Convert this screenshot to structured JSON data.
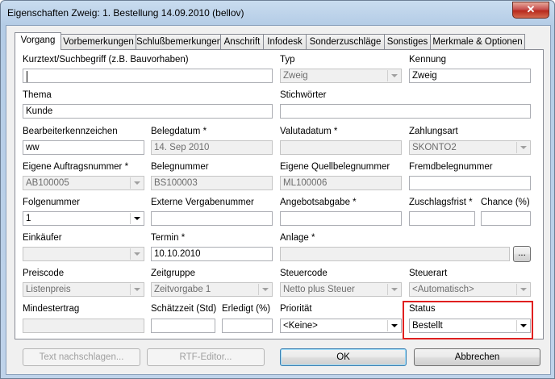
{
  "window": {
    "title": "Eigenschaften Zweig: 1. Bestellung 14.09.2010 (bellov)",
    "close_label": "✕"
  },
  "tabs": [
    {
      "label": "Vorgang"
    },
    {
      "label": "Vorbemerkungen"
    },
    {
      "label": "Schlußbemerkungen"
    },
    {
      "label": "Anschrift"
    },
    {
      "label": "Infodesk"
    },
    {
      "label": "Sonderzuschläge"
    },
    {
      "label": "Sonstiges"
    },
    {
      "label": "Merkmale & Optionen"
    }
  ],
  "fields": {
    "kurztext": {
      "label": "Kurztext/Suchbegriff (z.B. Bauvorhaben)",
      "value": ""
    },
    "typ": {
      "label": "Typ",
      "value": "Zweig"
    },
    "kennung": {
      "label": "Kennung",
      "value": "Zweig"
    },
    "thema": {
      "label": "Thema",
      "value": "Kunde"
    },
    "stichwoerter": {
      "label": "Stichwörter",
      "value": ""
    },
    "bearbeiter": {
      "label": "Bearbeiterkennzeichen",
      "value": "ww"
    },
    "belegdatum": {
      "label": "Belegdatum *",
      "value": "14. Sep 2010"
    },
    "valutadatum": {
      "label": "Valutadatum *",
      "value": ""
    },
    "zahlungsart": {
      "label": "Zahlungsart",
      "value": "SKONTO2"
    },
    "auftragsnummer": {
      "label": "Eigene Auftragsnummer *",
      "value": "AB100005"
    },
    "belegnummer": {
      "label": "Belegnummer",
      "value": "BS100003"
    },
    "quellbelegnummer": {
      "label": "Eigene Quellbelegnummer",
      "value": "ML100006"
    },
    "fremdbelegnummer": {
      "label": "Fremdbelegnummer",
      "value": ""
    },
    "folgenummer": {
      "label": "Folgenummer",
      "value": "1"
    },
    "vergabenummer": {
      "label": "Externe Vergabenummer",
      "value": ""
    },
    "angebotsabgabe": {
      "label": "Angebotsabgabe *",
      "value": ""
    },
    "zuschlagsfrist": {
      "label": "Zuschlagsfrist *",
      "value": ""
    },
    "chance": {
      "label": "Chance (%)",
      "value": ""
    },
    "einkaeufer": {
      "label": "Einkäufer",
      "value": ""
    },
    "termin": {
      "label": "Termin *",
      "value": "10.10.2010"
    },
    "anlage": {
      "label": "Anlage *",
      "value": "",
      "browse": "..."
    },
    "preiscode": {
      "label": "Preiscode",
      "value": "Listenpreis"
    },
    "zeitgruppe": {
      "label": "Zeitgruppe",
      "value": "Zeitvorgabe 1"
    },
    "steuercode": {
      "label": "Steuercode",
      "value": "Netto plus Steuer"
    },
    "steuerart": {
      "label": "Steuerart",
      "value": "<Automatisch>"
    },
    "mindestertrag": {
      "label": "Mindestertrag",
      "value": ""
    },
    "schaetzzeit": {
      "label": "Schätzzeit (Std)",
      "value": ""
    },
    "erledigt": {
      "label": "Erledigt (%)",
      "value": ""
    },
    "prioritaet": {
      "label": "Priorität",
      "value": "<Keine>"
    },
    "status": {
      "label": "Status",
      "value": "Bestellt"
    }
  },
  "buttons": {
    "text_nachschlagen": "Text nachschlagen...",
    "rtf_editor": "RTF-Editor...",
    "ok": "OK",
    "abbrechen": "Abbrechen"
  },
  "colors": {
    "highlight": "#e02020"
  }
}
